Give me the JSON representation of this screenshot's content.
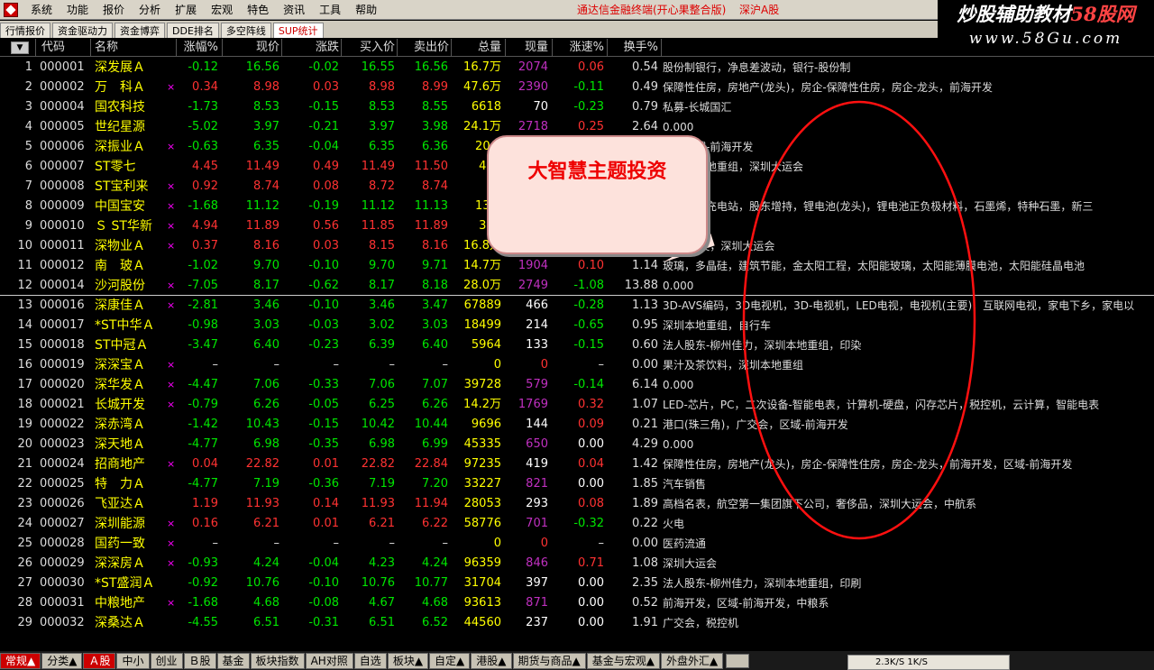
{
  "menu": {
    "items": [
      "系统",
      "功能",
      "报价",
      "分析",
      "扩展",
      "宏观",
      "特色",
      "资讯",
      "工具",
      "帮助"
    ],
    "app_title": "通达信金融终端(开心果整合版)",
    "market": "深沪A股"
  },
  "watermark": {
    "line1_prefix": "炒股辅助教材",
    "line1_highlight": "58股网",
    "line2": "www.58Gu.com"
  },
  "function_tabs": [
    "行情报价",
    "资金驱动力",
    "资金博弈",
    "DDE排名",
    "多空阵线",
    "SUP统计"
  ],
  "header": {
    "sort_label": "▼",
    "columns": [
      "代码",
      "名称",
      "涨幅%",
      "现价",
      "涨跌",
      "买入价",
      "卖出价",
      "总量",
      "现量",
      "涨速%",
      "换手%"
    ]
  },
  "callout": "大智慧主题投资",
  "rows": [
    {
      "idx": "1",
      "code": "000001",
      "name": "深发展Ａ",
      "flag": "",
      "chg": "-0.12",
      "price": "16.56",
      "diff": "-0.02",
      "bid": "16.55",
      "ask": "16.56",
      "vol": "16.7万",
      "cur": "2074",
      "spd": "0.06",
      "turn": "0.54",
      "concept": "股份制银行，净息差波动，银行-股份制",
      "tone": "down",
      "curc": "mag",
      "spdc": "up"
    },
    {
      "idx": "2",
      "code": "000002",
      "name": "万　科Ａ",
      "flag": "×",
      "chg": "0.34",
      "price": "8.98",
      "diff": "0.03",
      "bid": "8.98",
      "ask": "8.99",
      "vol": "47.6万",
      "cur": "2390",
      "spd": "-0.11",
      "turn": "0.49",
      "concept": "保障性住房，房地产(龙头)，房企-保障性住房，房企-龙头，前海开发",
      "tone": "up",
      "curc": "mag",
      "spdc": "down"
    },
    {
      "idx": "3",
      "code": "000004",
      "name": "国农科技",
      "flag": "",
      "chg": "-1.73",
      "price": "8.53",
      "diff": "-0.15",
      "bid": "8.53",
      "ask": "8.55",
      "vol": "6618",
      "cur": "70",
      "spd": "-0.23",
      "turn": "0.79",
      "concept": "私募-长城国汇",
      "tone": "down",
      "curc": "wht",
      "spdc": "down"
    },
    {
      "idx": "4",
      "code": "000005",
      "name": "世纪星源",
      "flag": "",
      "chg": "-5.02",
      "price": "3.97",
      "diff": "-0.21",
      "bid": "3.97",
      "ask": "3.98",
      "vol": "24.1万",
      "cur": "2718",
      "spd": "0.25",
      "turn": "2.64",
      "concept": "0.000",
      "tone": "down",
      "curc": "mag",
      "spdc": "up"
    },
    {
      "idx": "5",
      "code": "000006",
      "name": "深振业Ａ",
      "flag": "×",
      "chg": "-0.63",
      "price": "6.35",
      "diff": "-0.04",
      "bid": "6.35",
      "ask": "6.36",
      "vol": "20.2",
      "cur": "",
      "spd": "",
      "turn": "",
      "concept": "业，区域-前海开发",
      "tone": "down",
      "curc": "mag",
      "spdc": "up"
    },
    {
      "idx": "6",
      "code": "000007",
      "name": "ST零七",
      "flag": "",
      "chg": "4.45",
      "price": "11.49",
      "diff": "0.49",
      "bid": "11.49",
      "ask": "11.50",
      "vol": "478",
      "cur": "",
      "spd": "",
      "turn": "",
      "concept": "，深圳本地重组，深圳大运会",
      "tone": "up",
      "curc": "mag",
      "spdc": "up"
    },
    {
      "idx": "7",
      "code": "000008",
      "name": "ST宝利来",
      "flag": "×",
      "chg": "0.92",
      "price": "8.74",
      "diff": "0.08",
      "bid": "8.72",
      "ask": "8.74",
      "vol": "47",
      "cur": "",
      "spd": "",
      "turn": "",
      "concept": "重组",
      "tone": "up",
      "curc": "mag",
      "spdc": "up"
    },
    {
      "idx": "8",
      "code": "000009",
      "name": "中国宝安",
      "flag": "×",
      "chg": "-1.68",
      "price": "11.12",
      "diff": "-0.19",
      "bid": "11.12",
      "ask": "11.13",
      "vol": "13.9",
      "cur": "",
      "spd": "",
      "turn": "",
      "concept": "，电动车充电站，股东增持，锂电池(龙头)，锂电池正负极材料，石墨烯，特种石墨，新三",
      "tone": "down",
      "curc": "mag",
      "spdc": "up"
    },
    {
      "idx": "9",
      "code": "000010",
      "name": "Ｓ ST华新",
      "flag": "×",
      "chg": "4.94",
      "price": "11.89",
      "diff": "0.56",
      "bid": "11.85",
      "ask": "11.89",
      "vol": "351",
      "cur": "",
      "spd": "",
      "turn": "",
      "concept": "",
      "tone": "up",
      "curc": "mag",
      "spdc": "up"
    },
    {
      "idx": "10",
      "code": "000011",
      "name": "深物业Ａ",
      "flag": "×",
      "chg": "0.37",
      "price": "8.16",
      "diff": "0.03",
      "bid": "8.15",
      "ask": "8.16",
      "vol": "16.8万",
      "cur": "",
      "spd": "",
      "turn": "",
      "concept": "-前海开发，深圳大运会",
      "tone": "up",
      "curc": "mag",
      "spdc": "up"
    },
    {
      "idx": "11",
      "code": "000012",
      "name": "南　玻Ａ",
      "flag": "",
      "chg": "-1.02",
      "price": "9.70",
      "diff": "-0.10",
      "bid": "9.70",
      "ask": "9.71",
      "vol": "14.7万",
      "cur": "1904",
      "spd": "0.10",
      "turn": "1.14",
      "concept": "玻璃，多晶硅，建筑节能，金太阳工程，太阳能玻璃，太阳能薄膜电池，太阳能硅晶电池",
      "tone": "down",
      "curc": "mag",
      "spdc": "up"
    },
    {
      "idx": "12",
      "code": "000014",
      "name": "沙河股份",
      "flag": "×",
      "chg": "-7.05",
      "price": "8.17",
      "diff": "-0.62",
      "bid": "8.17",
      "ask": "8.18",
      "vol": "28.0万",
      "cur": "2749",
      "spd": "-1.08",
      "turn": "13.88",
      "concept": "0.000",
      "tone": "down",
      "curc": "mag",
      "spdc": "down"
    },
    {
      "idx": "13",
      "code": "000016",
      "name": "深康佳Ａ",
      "flag": "×",
      "chg": "-2.81",
      "price": "3.46",
      "diff": "-0.10",
      "bid": "3.46",
      "ask": "3.47",
      "vol": "67889",
      "cur": "466",
      "spd": "-0.28",
      "turn": "1.13",
      "concept": "3D-AVS编码，3D电视机，3D-电视机，LED电视，电视机(主要)，互联网电视，家电下乡，家电以",
      "tone": "down",
      "curc": "wht",
      "spdc": "down"
    },
    {
      "idx": "14",
      "code": "000017",
      "name": "*ST中华Ａ",
      "flag": "",
      "chg": "-0.98",
      "price": "3.03",
      "diff": "-0.03",
      "bid": "3.02",
      "ask": "3.03",
      "vol": "18499",
      "cur": "214",
      "spd": "-0.65",
      "turn": "0.95",
      "concept": "深圳本地重组，自行车",
      "tone": "down",
      "curc": "wht",
      "spdc": "down"
    },
    {
      "idx": "15",
      "code": "000018",
      "name": "ST中冠Ａ",
      "flag": "",
      "chg": "-3.47",
      "price": "6.40",
      "diff": "-0.23",
      "bid": "6.39",
      "ask": "6.40",
      "vol": "5964",
      "cur": "133",
      "spd": "-0.15",
      "turn": "0.60",
      "concept": "法人股东-柳州佳力，深圳本地重组，印染",
      "tone": "down",
      "curc": "wht",
      "spdc": "down"
    },
    {
      "idx": "16",
      "code": "000019",
      "name": "深深宝Ａ",
      "flag": "×",
      "chg": "–",
      "price": "–",
      "diff": "–",
      "bid": "–",
      "ask": "–",
      "vol": "0",
      "cur": "0",
      "spd": "–",
      "turn": "0.00",
      "concept": "果汁及茶饮料，深圳本地重组",
      "tone": "flat",
      "curc": "up",
      "spdc": "flat"
    },
    {
      "idx": "17",
      "code": "000020",
      "name": "深华发Ａ",
      "flag": "×",
      "chg": "-4.47",
      "price": "7.06",
      "diff": "-0.33",
      "bid": "7.06",
      "ask": "7.07",
      "vol": "39728",
      "cur": "579",
      "spd": "-0.14",
      "turn": "6.14",
      "concept": "0.000",
      "tone": "down",
      "curc": "mag",
      "spdc": "down"
    },
    {
      "idx": "18",
      "code": "000021",
      "name": "长城开发",
      "flag": "×",
      "chg": "-0.79",
      "price": "6.26",
      "diff": "-0.05",
      "bid": "6.25",
      "ask": "6.26",
      "vol": "14.2万",
      "cur": "1769",
      "spd": "0.32",
      "turn": "1.07",
      "concept": "LED-芯片，PC，二次设备-智能电表，计算机-硬盘，闪存芯片，税控机，云计算，智能电表",
      "tone": "down",
      "curc": "mag",
      "spdc": "up"
    },
    {
      "idx": "19",
      "code": "000022",
      "name": "深赤湾Ａ",
      "flag": "",
      "chg": "-1.42",
      "price": "10.43",
      "diff": "-0.15",
      "bid": "10.42",
      "ask": "10.44",
      "vol": "9696",
      "cur": "144",
      "spd": "0.09",
      "turn": "0.21",
      "concept": "港口(珠三角)，广交会，区域-前海开发",
      "tone": "down",
      "curc": "wht",
      "spdc": "up"
    },
    {
      "idx": "20",
      "code": "000023",
      "name": "深天地Ａ",
      "flag": "",
      "chg": "-4.77",
      "price": "6.98",
      "diff": "-0.35",
      "bid": "6.98",
      "ask": "6.99",
      "vol": "45335",
      "cur": "650",
      "spd": "0.00",
      "turn": "4.29",
      "concept": "0.000",
      "tone": "down",
      "curc": "mag",
      "spdc": "wht"
    },
    {
      "idx": "21",
      "code": "000024",
      "name": "招商地产",
      "flag": "×",
      "chg": "0.04",
      "price": "22.82",
      "diff": "0.01",
      "bid": "22.82",
      "ask": "22.84",
      "vol": "97235",
      "cur": "419",
      "spd": "0.04",
      "turn": "1.42",
      "concept": "保障性住房，房地产(龙头)，房企-保障性住房，房企-龙头，前海开发，区域-前海开发",
      "tone": "up",
      "curc": "wht",
      "spdc": "up"
    },
    {
      "idx": "22",
      "code": "000025",
      "name": "特　力Ａ",
      "flag": "",
      "chg": "-4.77",
      "price": "7.19",
      "diff": "-0.36",
      "bid": "7.19",
      "ask": "7.20",
      "vol": "33227",
      "cur": "821",
      "spd": "0.00",
      "turn": "1.85",
      "concept": "汽车销售",
      "tone": "down",
      "curc": "mag",
      "spdc": "wht"
    },
    {
      "idx": "23",
      "code": "000026",
      "name": "飞亚达Ａ",
      "flag": "",
      "chg": "1.19",
      "price": "11.93",
      "diff": "0.14",
      "bid": "11.93",
      "ask": "11.94",
      "vol": "28053",
      "cur": "293",
      "spd": "0.08",
      "turn": "1.89",
      "concept": "高档名表，航空第一集团旗下公司，奢侈品，深圳大运会，中航系",
      "tone": "up",
      "curc": "wht",
      "spdc": "up"
    },
    {
      "idx": "24",
      "code": "000027",
      "name": "深圳能源",
      "flag": "×",
      "chg": "0.16",
      "price": "6.21",
      "diff": "0.01",
      "bid": "6.21",
      "ask": "6.22",
      "vol": "58776",
      "cur": "701",
      "spd": "-0.32",
      "turn": "0.22",
      "concept": "火电",
      "tone": "up",
      "curc": "mag",
      "spdc": "down"
    },
    {
      "idx": "25",
      "code": "000028",
      "name": "国药一致",
      "flag": "×",
      "chg": "–",
      "price": "–",
      "diff": "–",
      "bid": "–",
      "ask": "–",
      "vol": "0",
      "cur": "0",
      "spd": "–",
      "turn": "0.00",
      "concept": "医药流通",
      "tone": "flat",
      "curc": "up",
      "spdc": "flat"
    },
    {
      "idx": "26",
      "code": "000029",
      "name": "深深房Ａ",
      "flag": "×",
      "chg": "-0.93",
      "price": "4.24",
      "diff": "-0.04",
      "bid": "4.23",
      "ask": "4.24",
      "vol": "96359",
      "cur": "846",
      "spd": "0.71",
      "turn": "1.08",
      "concept": "深圳大运会",
      "tone": "down",
      "curc": "mag",
      "spdc": "up"
    },
    {
      "idx": "27",
      "code": "000030",
      "name": "*ST盛润Ａ",
      "flag": "",
      "chg": "-0.92",
      "price": "10.76",
      "diff": "-0.10",
      "bid": "10.76",
      "ask": "10.77",
      "vol": "31704",
      "cur": "397",
      "spd": "0.00",
      "turn": "2.35",
      "concept": "法人股东-柳州佳力，深圳本地重组，印刷",
      "tone": "down",
      "curc": "wht",
      "spdc": "wht"
    },
    {
      "idx": "28",
      "code": "000031",
      "name": "中粮地产",
      "flag": "×",
      "chg": "-1.68",
      "price": "4.68",
      "diff": "-0.08",
      "bid": "4.67",
      "ask": "4.68",
      "vol": "93613",
      "cur": "871",
      "spd": "0.00",
      "turn": "0.52",
      "concept": "前海开发，区域-前海开发，中粮系",
      "tone": "down",
      "curc": "mag",
      "spdc": "wht"
    },
    {
      "idx": "29",
      "code": "000032",
      "name": "深桑达Ａ",
      "flag": "",
      "chg": "-4.55",
      "price": "6.51",
      "diff": "-0.31",
      "bid": "6.51",
      "ask": "6.52",
      "vol": "44560",
      "cur": "237",
      "spd": "0.00",
      "turn": "1.91",
      "concept": "广交会，税控机",
      "tone": "down",
      "curc": "wht",
      "spdc": "wht"
    }
  ],
  "bottom_tabs": [
    "常规▲",
    "分类▲",
    "Ａ股",
    "中小",
    "创业",
    "Ｂ股",
    "基金",
    "板块指数",
    "AH对照",
    "自选",
    "板块▲",
    "自定▲",
    "港股▲",
    "期货与商品▲",
    "基金与宏观▲",
    "外盘外汇▲"
  ],
  "status": "2.3K/S    1K/S"
}
